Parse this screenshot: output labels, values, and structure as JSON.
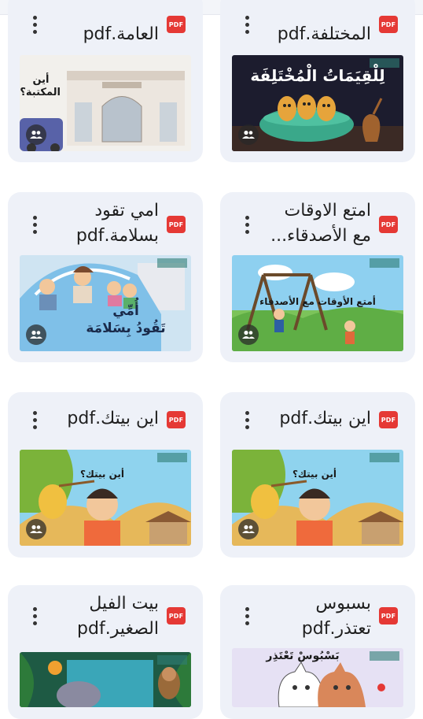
{
  "cards": [
    {
      "title": "المختلفة.pdf",
      "file_type": "PDF",
      "thumb_text": "لِلْقِيَمَاتُ الْمُخْتَلِفَة"
    },
    {
      "title": "العامة.pdf",
      "file_type": "PDF",
      "thumb_text": "أين\nالمكتبة؟"
    },
    {
      "title": "امتع الاوقات\nمع الأصدقاء...",
      "file_type": "PDF",
      "thumb_text": "أمتع الأوقات مع الأصدقاء"
    },
    {
      "title": "امي تقود\nبسلامة.pdf",
      "file_type": "PDF",
      "thumb_text": "أُمِّي\nتَقُودُ بِسَلامَة"
    },
    {
      "title": "اين بيتك.pdf",
      "file_type": "PDF",
      "thumb_text": "أين بيتك؟"
    },
    {
      "title": "اين بيتك.pdf",
      "file_type": "PDF",
      "thumb_text": "أين بيتك؟"
    },
    {
      "title": "بسبوس\nتعتذر.pdf",
      "file_type": "PDF",
      "thumb_text": "بَسْبُوسْ تَعْتَذِر"
    },
    {
      "title": "بيت الفيل\nالصغير.pdf",
      "file_type": "PDF",
      "thumb_text": ""
    }
  ],
  "colors": {
    "card_bg": "#eef1f8",
    "pdf_badge": "#e53935"
  },
  "icons": {
    "pdf": "pdf-icon",
    "more": "more-vert-icon",
    "shared": "people-icon"
  }
}
